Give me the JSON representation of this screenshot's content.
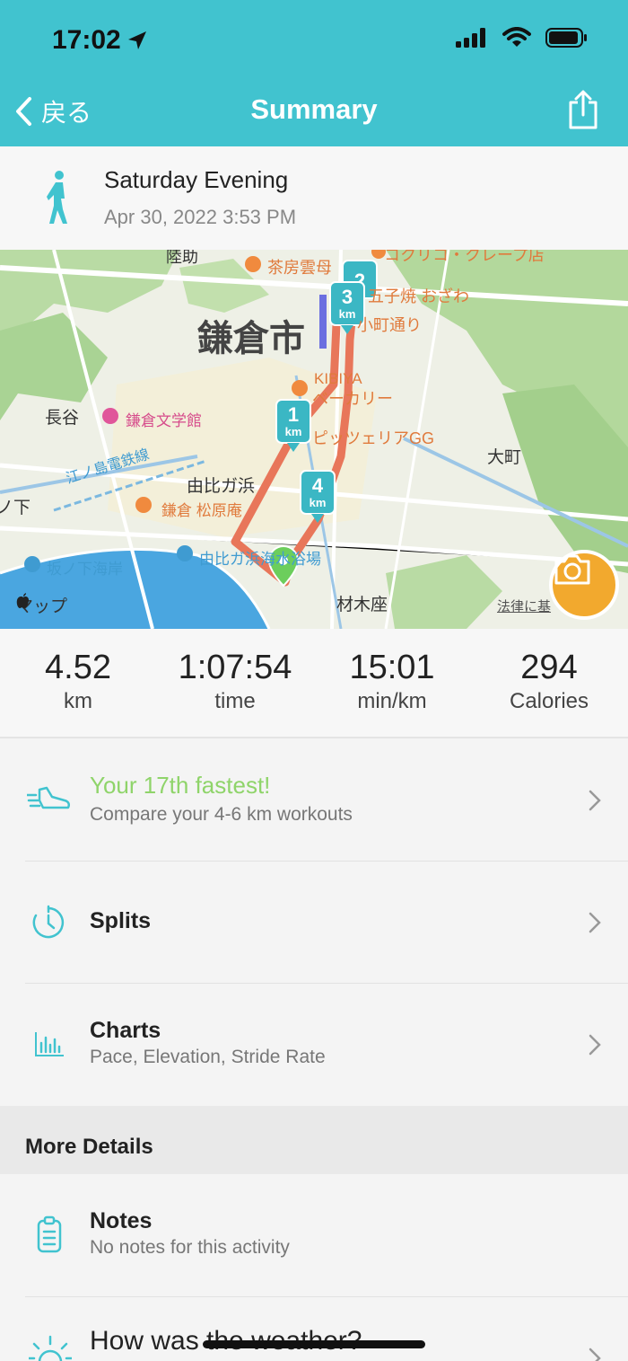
{
  "status_bar": {
    "time": "17:02"
  },
  "header": {
    "back_label": "戻る",
    "title": "Summary"
  },
  "activity": {
    "title": "Saturday Evening",
    "date": "Apr 30, 2022 3:53 PM"
  },
  "map": {
    "labels": {
      "kamakura_city": "鎌倉市",
      "hase": "長谷",
      "museum": "鎌倉文学館",
      "yuigahama": "由比ガ浜",
      "enoden": "江ノ島電鉄線",
      "matsubara": "鎌倉 松原庵",
      "sakanoshita_beach": "坂ノ下海岸",
      "yuigahama_beach": "由比ガ浜海水浴場",
      "zaimokuza": "材木座",
      "omachi": "大町",
      "kibiya": "KIBIYA",
      "bakery": "ベーカリー",
      "pizzeria": "ピッツェリアGG",
      "cafe": "茶房雲母",
      "gozayaki": "五子焼 おざわ",
      "komachi": "小町通り",
      "top_left": "陸助",
      "top_right": "コクリコ・クレープ店",
      "left_edge": "ノ下",
      "maps_brand": "マップ",
      "legal": "法律に基"
    },
    "markers": [
      {
        "num": "1",
        "unit": "km"
      },
      {
        "num": "2",
        "unit": ""
      },
      {
        "num": "3",
        "unit": "km"
      },
      {
        "num": "4",
        "unit": "km"
      }
    ]
  },
  "stats": [
    {
      "value": "4.52",
      "unit": "km"
    },
    {
      "value": "1:07:54",
      "unit": "time"
    },
    {
      "value": "15:01",
      "unit": "min/km"
    },
    {
      "value": "294",
      "unit": "Calories"
    }
  ],
  "rows": {
    "fastest": {
      "title": "Your 17th fastest!",
      "subtitle": "Compare your 4-6 km workouts"
    },
    "splits": {
      "title": "Splits"
    },
    "charts": {
      "title": "Charts",
      "subtitle": "Pace, Elevation, Stride Rate"
    },
    "section_title": "More Details",
    "notes": {
      "title": "Notes",
      "subtitle": "No notes for this activity"
    },
    "weather": {
      "title": "How was the weather?"
    }
  },
  "colors": {
    "header": "#41c3cf",
    "accent_green": "#8fd46a",
    "route": "#e8765a",
    "camera": "#f2a92e"
  }
}
